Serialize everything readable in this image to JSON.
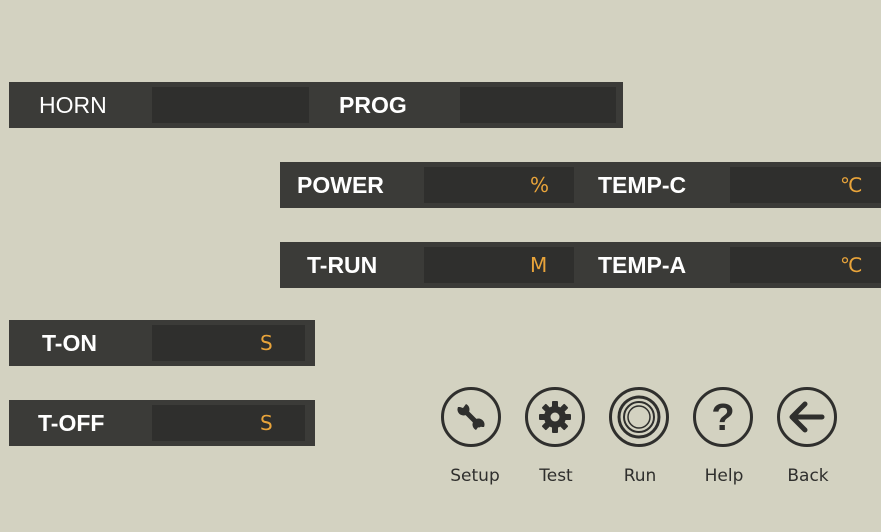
{
  "colors": {
    "background": "#d3d2c1",
    "strip": "#3b3b38",
    "field": "#2f2f2d",
    "label_text": "#ffffff",
    "unit_text": "#e9a43a",
    "icon": "#2f2f2d"
  },
  "rows": {
    "horn": {
      "label": "HORN"
    },
    "prog": {
      "label": "PROG"
    },
    "power": {
      "label": "POWER",
      "unit": "%"
    },
    "temp_c": {
      "label": "TEMP-C",
      "unit": "℃"
    },
    "t_run": {
      "label": "T-RUN",
      "unit": "M"
    },
    "temp_a": {
      "label": "TEMP-A",
      "unit": "℃"
    },
    "t_on": {
      "label": "T-ON",
      "unit": "S"
    },
    "t_off": {
      "label": "T-OFF",
      "unit": "S"
    }
  },
  "buttons": [
    {
      "label": "Setup",
      "icon": "wrench-icon"
    },
    {
      "label": "Test",
      "icon": "gear-icon"
    },
    {
      "label": "Run",
      "icon": "concentric-rings-icon"
    },
    {
      "label": "Help",
      "icon": "question-mark-icon"
    },
    {
      "label": "Back",
      "icon": "arrow-left-icon"
    }
  ]
}
